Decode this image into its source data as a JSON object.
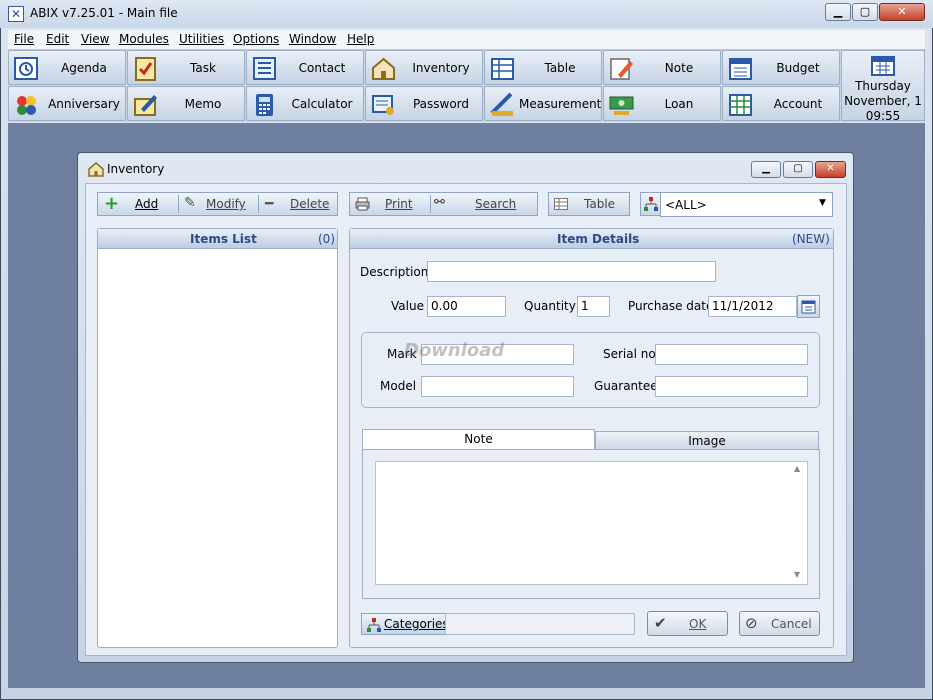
{
  "app": {
    "title": "ABIX v7.25.01  -  Main file"
  },
  "menu": [
    {
      "label": "File"
    },
    {
      "label": "Edit"
    },
    {
      "label": "View"
    },
    {
      "label": "Modules"
    },
    {
      "label": "Utilities"
    },
    {
      "label": "Options"
    },
    {
      "label": "Window"
    },
    {
      "label": "Help"
    }
  ],
  "toolbar": {
    "row1": [
      {
        "label": "Agenda",
        "icon": "agenda-icon"
      },
      {
        "label": "Task",
        "icon": "task-icon"
      },
      {
        "label": "Contact",
        "icon": "contact-icon"
      },
      {
        "label": "Inventory",
        "icon": "inventory-icon"
      },
      {
        "label": "Table",
        "icon": "table-icon"
      },
      {
        "label": "Note",
        "icon": "note-icon"
      },
      {
        "label": "Budget",
        "icon": "budget-icon"
      }
    ],
    "row2": [
      {
        "label": "Anniversary",
        "icon": "anniversary-icon"
      },
      {
        "label": "Memo",
        "icon": "memo-icon"
      },
      {
        "label": "Calculator",
        "icon": "calculator-icon"
      },
      {
        "label": "Password",
        "icon": "password-icon"
      },
      {
        "label": "Measurement",
        "icon": "measurement-icon"
      },
      {
        "label": "Loan",
        "icon": "loan-icon"
      },
      {
        "label": "Account",
        "icon": "account-icon"
      }
    ],
    "date": {
      "day": "Thursday",
      "date": "November, 1",
      "time": "09:55"
    }
  },
  "inventory": {
    "title": "Inventory",
    "actions": {
      "add": "Add",
      "modify": "Modify",
      "delete": "Delete",
      "print": "Print",
      "search": "Search",
      "table": "Table"
    },
    "filter": "<ALL>",
    "items_list": {
      "title": "Items List",
      "count": "(0)"
    },
    "details": {
      "title": "Item Details",
      "status": "(NEW)",
      "description_label": "Description",
      "description": "",
      "value_label": "Value",
      "value": "0.00",
      "quantity_label": "Quantity",
      "quantity": "1",
      "purchase_date_label": "Purchase date",
      "purchase_date": "11/1/2012",
      "mark_label": "Mark",
      "mark": "",
      "serial_label": "Serial no",
      "serial": "",
      "model_label": "Model",
      "model": "",
      "guarantee_label": "Guarantee",
      "guarantee": ""
    },
    "tabs": {
      "note": "Note",
      "image": "Image"
    },
    "watermark": "Download",
    "categories_label": "Categories",
    "ok_label": "OK",
    "cancel_label": "Cancel"
  }
}
